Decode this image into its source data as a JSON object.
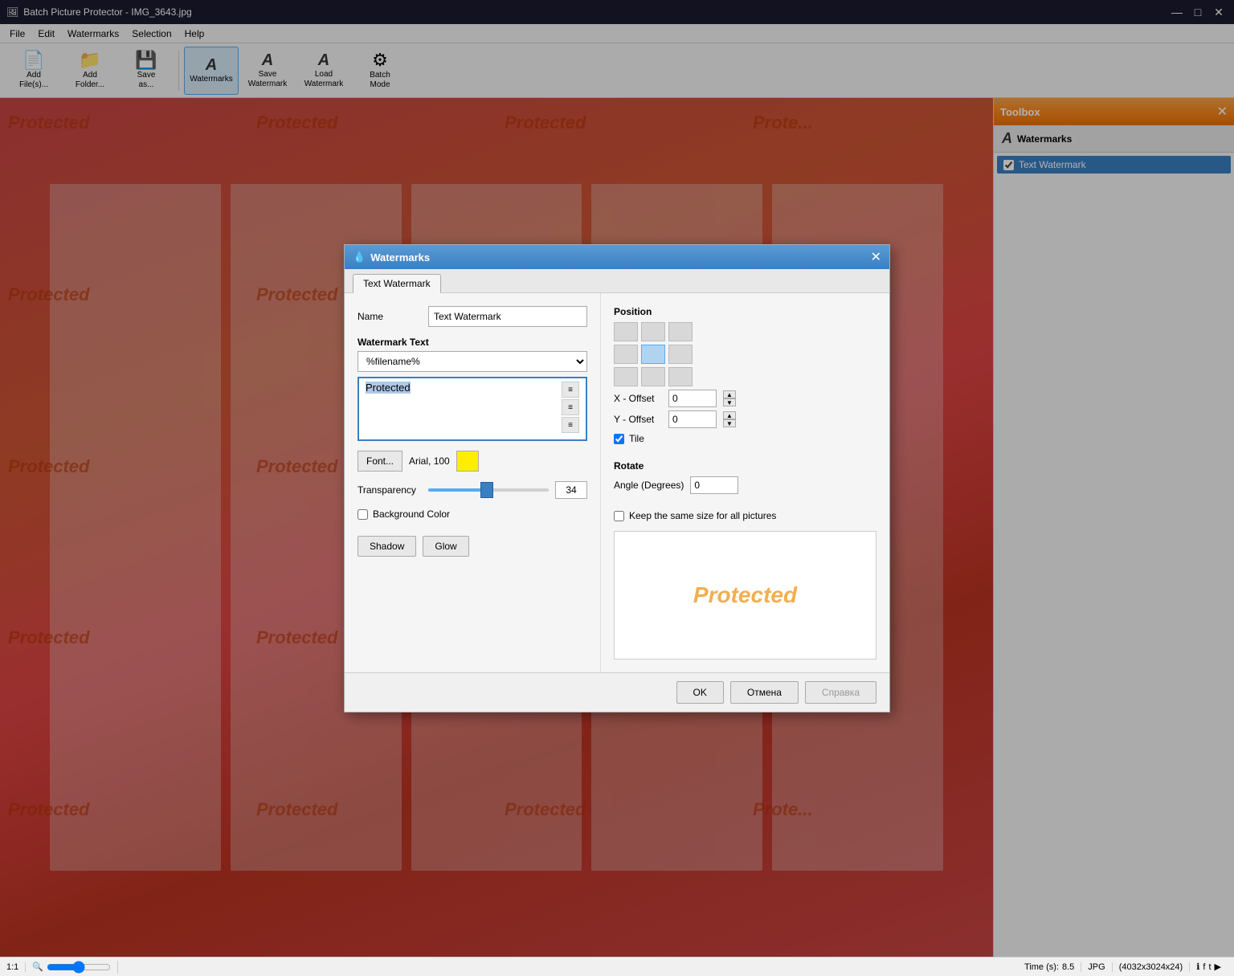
{
  "app": {
    "title": "Batch Picture Protector - IMG_3643.jpg",
    "icon": "🖼"
  },
  "titlebar": {
    "minimize": "—",
    "maximize": "□",
    "close": "✕"
  },
  "menu": {
    "items": [
      "File",
      "Edit",
      "Watermarks",
      "Selection",
      "Help"
    ]
  },
  "toolbar": {
    "buttons": [
      {
        "id": "add-files",
        "icon": "📄",
        "label": "Add\nFile(s)..."
      },
      {
        "id": "add-folder",
        "icon": "📁",
        "label": "Add\nFolder..."
      },
      {
        "id": "save-as",
        "icon": "💾",
        "label": "Save\nas..."
      },
      {
        "id": "watermarks",
        "icon": "A",
        "label": "Watermarks",
        "active": true
      },
      {
        "id": "save-watermark",
        "icon": "A",
        "label": "Save\nWatermark"
      },
      {
        "id": "load-watermark",
        "icon": "A",
        "label": "Load\nWatermark"
      },
      {
        "id": "batch-mode",
        "icon": "⚙",
        "label": "Batch\nMode"
      }
    ]
  },
  "toolbox": {
    "title": "Toolbox",
    "section": "Watermarks",
    "watermarks": [
      {
        "name": "Text Watermark",
        "checked": true
      }
    ]
  },
  "watermarks_dialog": {
    "title": "Watermarks",
    "tabs": [
      "Text Watermark"
    ],
    "active_tab": "Text Watermark",
    "form": {
      "name_label": "Name",
      "name_value": "Text Watermark",
      "watermark_text_label": "Watermark Text",
      "text_dropdown": "%filename%",
      "text_content": "Protected",
      "font_btn": "Font...",
      "font_info": "Arial, 100",
      "color_label": "",
      "transparency_label": "Transparency",
      "transparency_value": "34",
      "background_color_label": "Background Color",
      "background_color_checked": false,
      "shadow_btn": "Shadow",
      "glow_btn": "Glow"
    },
    "position": {
      "label": "Position",
      "x_offset_label": "X - Offset",
      "x_offset_value": "0",
      "y_offset_label": "Y - Offset",
      "y_offset_value": "0",
      "tile_label": "Tile",
      "tile_checked": true
    },
    "rotate": {
      "label": "Rotate",
      "angle_label": "Angle (Degrees)",
      "angle_value": "0"
    },
    "keep_size_label": "Keep the same size for all pictures",
    "keep_size_checked": false,
    "preview_text": "Protected",
    "buttons": {
      "ok": "OK",
      "cancel": "Отмена",
      "help": "Справка"
    }
  },
  "statusbar": {
    "zoom": "1:1",
    "time_label": "Time (s):",
    "time_value": "8.5",
    "format": "JPG",
    "dimensions": "(4032x3024x24)"
  }
}
